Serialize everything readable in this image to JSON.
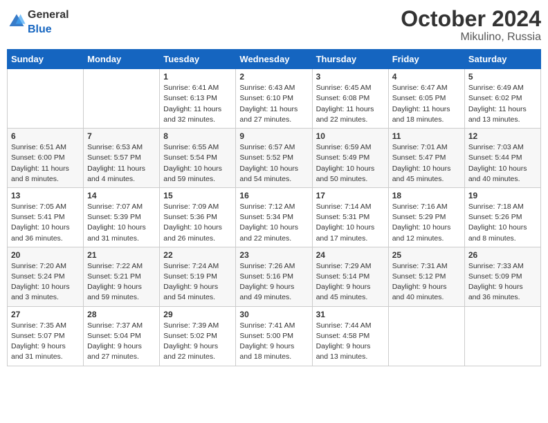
{
  "header": {
    "logo_general": "General",
    "logo_blue": "Blue",
    "month_title": "October 2024",
    "location": "Mikulino, Russia"
  },
  "weekdays": [
    "Sunday",
    "Monday",
    "Tuesday",
    "Wednesday",
    "Thursday",
    "Friday",
    "Saturday"
  ],
  "weeks": [
    [
      {
        "day": "",
        "info": ""
      },
      {
        "day": "",
        "info": ""
      },
      {
        "day": "1",
        "info": "Sunrise: 6:41 AM\nSunset: 6:13 PM\nDaylight: 11 hours and 32 minutes."
      },
      {
        "day": "2",
        "info": "Sunrise: 6:43 AM\nSunset: 6:10 PM\nDaylight: 11 hours and 27 minutes."
      },
      {
        "day": "3",
        "info": "Sunrise: 6:45 AM\nSunset: 6:08 PM\nDaylight: 11 hours and 22 minutes."
      },
      {
        "day": "4",
        "info": "Sunrise: 6:47 AM\nSunset: 6:05 PM\nDaylight: 11 hours and 18 minutes."
      },
      {
        "day": "5",
        "info": "Sunrise: 6:49 AM\nSunset: 6:02 PM\nDaylight: 11 hours and 13 minutes."
      }
    ],
    [
      {
        "day": "6",
        "info": "Sunrise: 6:51 AM\nSunset: 6:00 PM\nDaylight: 11 hours and 8 minutes."
      },
      {
        "day": "7",
        "info": "Sunrise: 6:53 AM\nSunset: 5:57 PM\nDaylight: 11 hours and 4 minutes."
      },
      {
        "day": "8",
        "info": "Sunrise: 6:55 AM\nSunset: 5:54 PM\nDaylight: 10 hours and 59 minutes."
      },
      {
        "day": "9",
        "info": "Sunrise: 6:57 AM\nSunset: 5:52 PM\nDaylight: 10 hours and 54 minutes."
      },
      {
        "day": "10",
        "info": "Sunrise: 6:59 AM\nSunset: 5:49 PM\nDaylight: 10 hours and 50 minutes."
      },
      {
        "day": "11",
        "info": "Sunrise: 7:01 AM\nSunset: 5:47 PM\nDaylight: 10 hours and 45 minutes."
      },
      {
        "day": "12",
        "info": "Sunrise: 7:03 AM\nSunset: 5:44 PM\nDaylight: 10 hours and 40 minutes."
      }
    ],
    [
      {
        "day": "13",
        "info": "Sunrise: 7:05 AM\nSunset: 5:41 PM\nDaylight: 10 hours and 36 minutes."
      },
      {
        "day": "14",
        "info": "Sunrise: 7:07 AM\nSunset: 5:39 PM\nDaylight: 10 hours and 31 minutes."
      },
      {
        "day": "15",
        "info": "Sunrise: 7:09 AM\nSunset: 5:36 PM\nDaylight: 10 hours and 26 minutes."
      },
      {
        "day": "16",
        "info": "Sunrise: 7:12 AM\nSunset: 5:34 PM\nDaylight: 10 hours and 22 minutes."
      },
      {
        "day": "17",
        "info": "Sunrise: 7:14 AM\nSunset: 5:31 PM\nDaylight: 10 hours and 17 minutes."
      },
      {
        "day": "18",
        "info": "Sunrise: 7:16 AM\nSunset: 5:29 PM\nDaylight: 10 hours and 12 minutes."
      },
      {
        "day": "19",
        "info": "Sunrise: 7:18 AM\nSunset: 5:26 PM\nDaylight: 10 hours and 8 minutes."
      }
    ],
    [
      {
        "day": "20",
        "info": "Sunrise: 7:20 AM\nSunset: 5:24 PM\nDaylight: 10 hours and 3 minutes."
      },
      {
        "day": "21",
        "info": "Sunrise: 7:22 AM\nSunset: 5:21 PM\nDaylight: 9 hours and 59 minutes."
      },
      {
        "day": "22",
        "info": "Sunrise: 7:24 AM\nSunset: 5:19 PM\nDaylight: 9 hours and 54 minutes."
      },
      {
        "day": "23",
        "info": "Sunrise: 7:26 AM\nSunset: 5:16 PM\nDaylight: 9 hours and 49 minutes."
      },
      {
        "day": "24",
        "info": "Sunrise: 7:29 AM\nSunset: 5:14 PM\nDaylight: 9 hours and 45 minutes."
      },
      {
        "day": "25",
        "info": "Sunrise: 7:31 AM\nSunset: 5:12 PM\nDaylight: 9 hours and 40 minutes."
      },
      {
        "day": "26",
        "info": "Sunrise: 7:33 AM\nSunset: 5:09 PM\nDaylight: 9 hours and 36 minutes."
      }
    ],
    [
      {
        "day": "27",
        "info": "Sunrise: 7:35 AM\nSunset: 5:07 PM\nDaylight: 9 hours and 31 minutes."
      },
      {
        "day": "28",
        "info": "Sunrise: 7:37 AM\nSunset: 5:04 PM\nDaylight: 9 hours and 27 minutes."
      },
      {
        "day": "29",
        "info": "Sunrise: 7:39 AM\nSunset: 5:02 PM\nDaylight: 9 hours and 22 minutes."
      },
      {
        "day": "30",
        "info": "Sunrise: 7:41 AM\nSunset: 5:00 PM\nDaylight: 9 hours and 18 minutes."
      },
      {
        "day": "31",
        "info": "Sunrise: 7:44 AM\nSunset: 4:58 PM\nDaylight: 9 hours and 13 minutes."
      },
      {
        "day": "",
        "info": ""
      },
      {
        "day": "",
        "info": ""
      }
    ]
  ]
}
